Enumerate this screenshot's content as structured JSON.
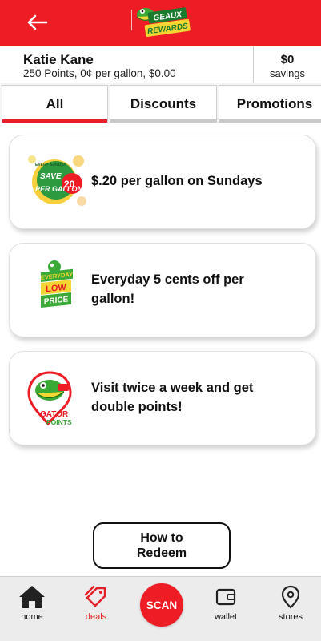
{
  "header": {
    "back_icon": "arrow-left-icon",
    "logo_text_line1": "GEAUX",
    "logo_text_line2": "REWARDS",
    "brand_color": "#ee1c25"
  },
  "user": {
    "name": "Katie Kane",
    "stats": "250 Points, 0¢ per gallon, $0.00",
    "savings_amount": "$0",
    "savings_label": "savings"
  },
  "tabs": [
    {
      "label": "All",
      "selected": true
    },
    {
      "label": "Discounts",
      "selected": false
    },
    {
      "label": "Promotions",
      "selected": false
    }
  ],
  "offers": [
    {
      "text": "$.20 per gallon on Sundays",
      "image": "save-20-per-gallon-badge",
      "badge_small": "EVERY SUNDAY",
      "badge_main": "SAVE",
      "badge_amount": "20",
      "badge_sub": "PER GALLON"
    },
    {
      "text": "Everyday 5 cents off per gallon!",
      "image": "everyday-low-price-badge",
      "badge_line1": "EVERYDAY",
      "badge_line2": "LOW",
      "badge_line3": "PRICE"
    },
    {
      "text": "Visit twice a week and get double points!",
      "image": "gator-points-logo",
      "badge_line1": "GATOR",
      "badge_line2": "POINTS"
    }
  ],
  "redeem_button": {
    "line1": "How to",
    "line2": "Redeem"
  },
  "bottom_nav": {
    "home": {
      "label": "home",
      "icon": "home-icon"
    },
    "deals": {
      "label": "deals",
      "icon": "tag-icon"
    },
    "scan": {
      "label": "SCAN"
    },
    "wallet": {
      "label": "wallet",
      "icon": "wallet-icon"
    },
    "stores": {
      "label": "stores",
      "icon": "location-pin-icon"
    }
  }
}
